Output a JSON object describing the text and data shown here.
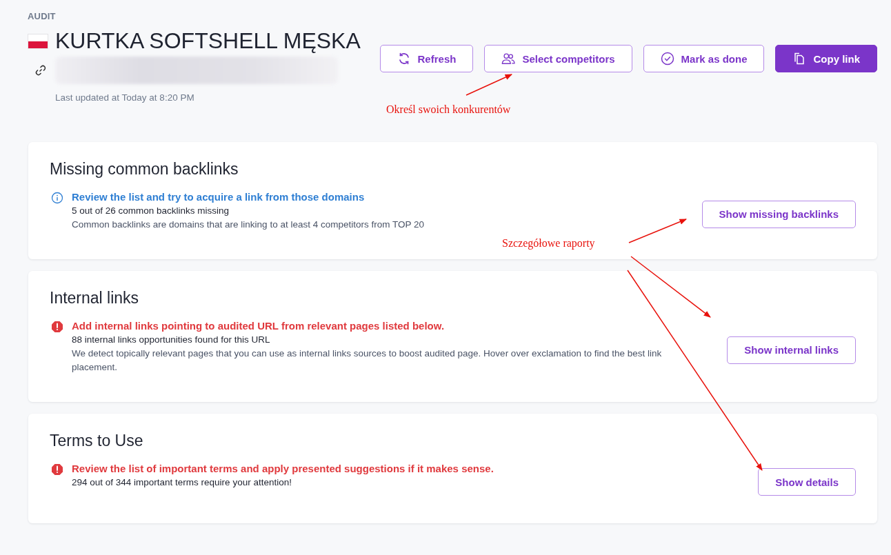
{
  "header": {
    "section": "AUDIT",
    "title": "KURTKA SOFTSHELL MĘSKA",
    "last_updated": "Last updated at Today at 8:20 PM"
  },
  "actions": [
    {
      "label": "Refresh",
      "kind": "refresh",
      "primary": false
    },
    {
      "label": "Select competitors",
      "kind": "users",
      "primary": false
    },
    {
      "label": "Mark as done",
      "kind": "check",
      "primary": false
    },
    {
      "label": "Copy link",
      "kind": "copy",
      "primary": true
    }
  ],
  "cards": [
    {
      "title": "Missing common backlinks",
      "kind": "info",
      "message": "Review the list and try to acquire a link from those domains",
      "summary": "5 out of 26 common backlinks missing",
      "description": "Common backlinks are domains that are linking to at least 4 competitors from TOP 20",
      "button": "Show missing backlinks"
    },
    {
      "title": "Internal links",
      "kind": "error",
      "message": "Add internal links pointing to audited URL from relevant pages listed below.",
      "summary": "88 internal links opportunities found for this URL",
      "description": "We detect topically relevant pages that you can use as internal links sources to boost audited page. Hover over exclamation to find the best link placement.",
      "button": "Show internal links"
    },
    {
      "title": "Terms to Use",
      "kind": "error",
      "message": "Review the list of important terms and apply presented suggestions if it makes sense.",
      "summary": "294 out of 344 important terms require your attention!",
      "button": "Show details"
    }
  ],
  "annotations": [
    {
      "text": "Określ swoich konkurentów"
    },
    {
      "text": "Szczegółowe raporty"
    }
  ]
}
